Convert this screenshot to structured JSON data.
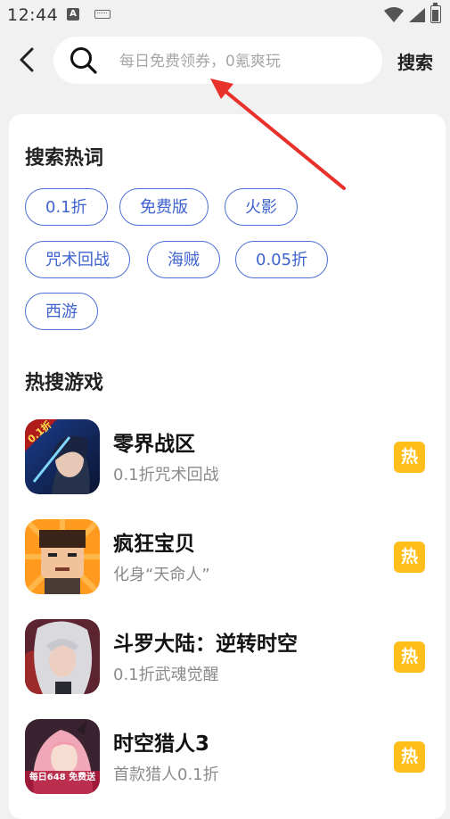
{
  "status_bar": {
    "time": "12:44",
    "notification_glyph": "A"
  },
  "search": {
    "placeholder": "每日免费领券，0氪爽玩",
    "submit_label": "搜索"
  },
  "hot_words": {
    "title": "搜索热词",
    "items": [
      "0.1折",
      "免费版",
      "火影",
      "咒术回战",
      "海贼",
      "0.05折",
      "西游"
    ]
  },
  "hot_games": {
    "title": "热搜游戏",
    "badge": "热",
    "items": [
      {
        "name": "零界战区",
        "desc": "0.1折咒术回战",
        "icon_overlay": "0.1折",
        "icon": "anime-swordsman-icon"
      },
      {
        "name": "疯狂宝贝",
        "desc": "化身“天命人”",
        "icon": "cartoon-boy-icon"
      },
      {
        "name": "斗罗大陆：逆转时空",
        "desc": "0.1折武魂觉醒",
        "icon": "silver-hair-hero-icon"
      },
      {
        "name": "时空猎人3",
        "desc": "首款猎人0.1折",
        "icon_overlay": "每日648 免费送",
        "icon": "pink-hair-girl-icon"
      }
    ]
  },
  "colors": {
    "accent": "#4d6fd6",
    "badge": "#ffbe1a",
    "annotation_arrow": "#e8312a"
  }
}
